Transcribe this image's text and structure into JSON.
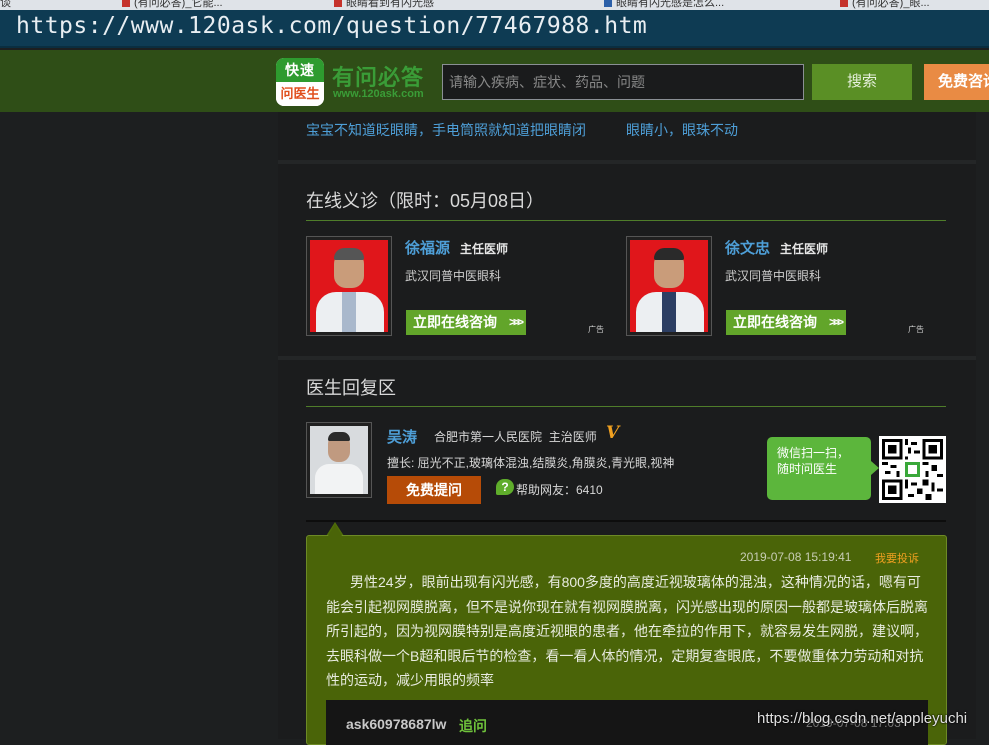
{
  "browser": {
    "tabs": [
      {
        "label": "谈"
      },
      {
        "label": "(有问必答)_它能..."
      },
      {
        "label": "眼睛看到有闪光感"
      },
      {
        "label": "眼睛有闪光感是怎么..."
      },
      {
        "label": "(有问必答)_眼..."
      }
    ],
    "url": "https://www.120ask.com/question/77467988.htm"
  },
  "header": {
    "logo_top": "快速",
    "logo_bottom": "问医生",
    "brand_name": "有问必答",
    "brand_url": "www.120ask.com",
    "search_placeholder": "请输入疾病、症状、药品、问题",
    "search_button": "搜索",
    "consult_button": "免费咨询"
  },
  "related": {
    "links": [
      "宝宝不知道眨眼睛，手电筒照就知道把眼睛闭",
      "眼睛小，眼珠不动"
    ]
  },
  "online_clinic": {
    "title": "在线义诊（限时：05月08日）",
    "doctors": [
      {
        "name": "徐福源",
        "title": "主任医师",
        "dept": "武汉同普中医眼科",
        "button": "立即在线咨询",
        "ad": "广告"
      },
      {
        "name": "徐文忠",
        "title": "主任医师",
        "dept": "武汉同普中医眼科",
        "button": "立即在线咨询",
        "ad": "广告"
      }
    ]
  },
  "reply_section": {
    "title": "医生回复区",
    "doctor": {
      "name": "吴涛",
      "hospital": "合肥市第一人民医院",
      "title": "主治医师",
      "verified_mark": "V",
      "specialty": "擅长: 屈光不正,玻璃体混浊,结膜炎,角膜炎,青光眼,视神",
      "ask_button": "免费提问",
      "help_icon": "?",
      "helped": "帮助网友：6410"
    },
    "wechat": {
      "line1": "微信扫一扫，",
      "line2": "随时问医生"
    },
    "reply": {
      "date": "2019-07-08 15:19:41",
      "report": "我要投诉",
      "text": "男性24岁，眼前出现有闪光感，有800多度的高度近视玻璃体的混浊，这种情况的话，嗯有可能会引起视网膜脱离，但不是说你现在就有视网膜脱离，闪光感出现的原因一般都是玻璃体后脱离所引起的，因为视网膜特别是高度近视眼的患者，他在牵拉的作用下，就容易发生网脱，建议啊，去眼科做一个B超和眼后节的检查，看一看人体的情况，定期复查眼底，不要做重体力劳动和对抗性的运动，减少用眼的频率"
    },
    "followup": {
      "user": "ask60978687lw",
      "tag": "追问",
      "date": "2019-07-08 17:03"
    }
  },
  "watermark": "https://blog.csdn.net/appleyuchi"
}
